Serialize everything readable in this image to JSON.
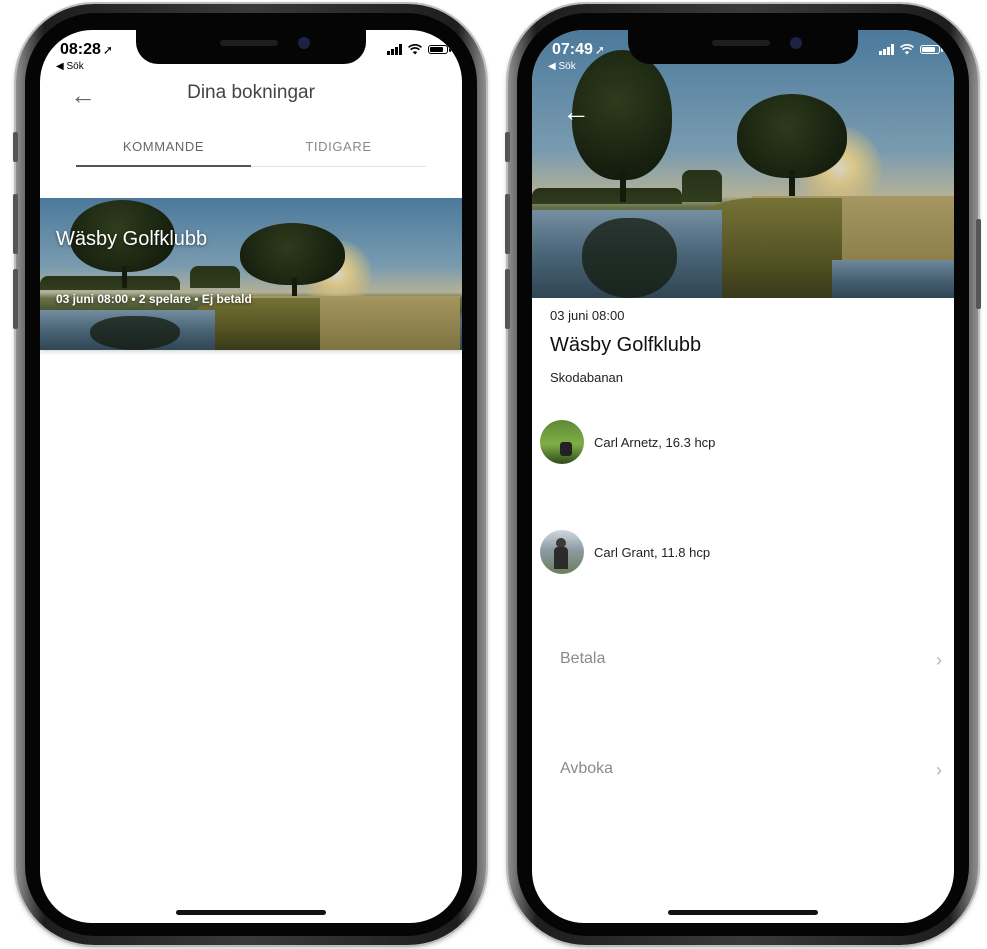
{
  "left_screen": {
    "status": {
      "time": "08:28",
      "back_app": "◀ Sök"
    },
    "header": {
      "title": "Dina bokningar"
    },
    "tabs": [
      {
        "label": "KOMMANDE",
        "active": true
      },
      {
        "label": "TIDIGARE",
        "active": false
      }
    ],
    "booking_card": {
      "club": "Wäsby Golfklubb",
      "summary": "03 juni 08:00 • 2 spelare • Ej betald"
    }
  },
  "right_screen": {
    "status": {
      "time": "07:49",
      "back_app": "◀ Sök"
    },
    "booking": {
      "date_time": "03 juni 08:00",
      "club": "Wäsby Golfklubb",
      "course": "Skodabanan"
    },
    "players": [
      {
        "label": "Carl Arnetz, 16.3 hcp"
      },
      {
        "label": "Carl Grant, 11.8 hcp"
      }
    ],
    "actions": [
      {
        "label": "Betala"
      },
      {
        "label": "Avboka"
      }
    ]
  },
  "icons": {
    "back": "arrow-left-icon",
    "chevron": "chevron-right-icon",
    "location": "location-arrow-icon",
    "signal": "signal-bars-icon",
    "wifi": "wifi-icon",
    "battery": "battery-icon"
  },
  "colors": {
    "text_primary": "#111111",
    "text_muted": "#8a8a8a",
    "tab_active_underline": "#555555"
  }
}
